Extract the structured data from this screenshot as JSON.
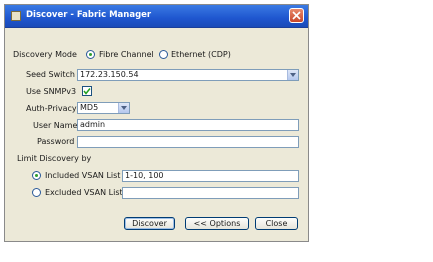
{
  "window": {
    "title": "Discover - Fabric Manager"
  },
  "discovery_mode": {
    "label": "Discovery Mode",
    "options": [
      "Fibre Channel",
      "Ethernet (CDP)"
    ],
    "selected": "Fibre Channel"
  },
  "seed_switch": {
    "label": "Seed Switch",
    "value": "172.23.150.54"
  },
  "snmpv3": {
    "label": "Use SNMPv3",
    "checked": true
  },
  "auth_privacy": {
    "label": "Auth-Privacy",
    "value": "MD5"
  },
  "user_name": {
    "label": "User Name",
    "value": "admin"
  },
  "password": {
    "label": "Password",
    "value": ""
  },
  "limit_discovery": {
    "label": "Limit Discovery by",
    "included_label": "Included VSAN List",
    "included_value": "1-10, 100",
    "excluded_label": "Excluded VSAN List",
    "excluded_value": "",
    "selected": "included"
  },
  "buttons": {
    "discover": "Discover",
    "options": "<< Options",
    "close": "Close"
  }
}
